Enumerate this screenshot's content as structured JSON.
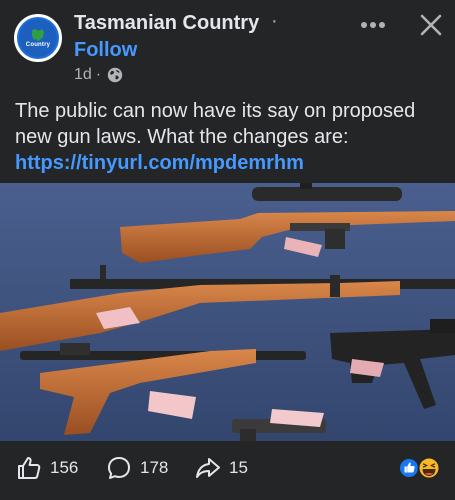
{
  "post": {
    "page_name": "Tasmanian Country",
    "name_separator": "·",
    "avatar_text": "Country",
    "follow_label": "Follow",
    "time": "1d",
    "time_separator": "·",
    "privacy_icon": "globe-icon",
    "text": "The public can now have its say on proposed new gun laws. What the changes are: ",
    "link": "https://tinyurl.com/mpdemrhm"
  },
  "header": {
    "more_icon": "more-icon",
    "close_icon": "close-icon"
  },
  "actions": {
    "like_count": "156",
    "comment_count": "178",
    "share_count": "15",
    "reaction_icons": [
      "like-reaction-icon",
      "haha-reaction-icon"
    ]
  },
  "colors": {
    "background": "#242526",
    "link": "#4599ff",
    "like_blue": "#1877f2",
    "haha_yellow": "#f7b928"
  }
}
